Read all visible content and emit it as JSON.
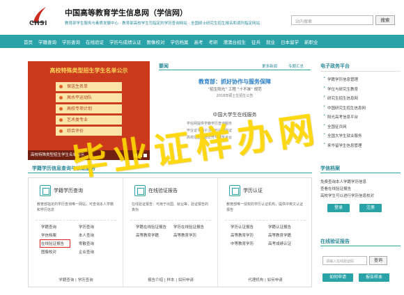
{
  "header": {
    "logo_text": "CHSI",
    "title": "中国高等教育学生信息网（学信网）",
    "slogan": "教育部学生服务与素质发展中心 · 教育部高校学生司指定的学历查询网站 · 全国硕士研究生招生报名和调剂指定网站",
    "search_placeholder": "站内搜索",
    "search_button": "搜索"
  },
  "nav": {
    "items": [
      "首页",
      "学籍查询",
      "学历查询",
      "在线验证",
      "学历与成绩认证",
      "图像校对",
      "学信档案",
      "高考",
      "考研",
      "港澳台招生",
      "征兵",
      "就业",
      "日本留学",
      "新职业"
    ]
  },
  "banner": {
    "title": "高校特殊类型招生学生名单公示",
    "items": [
      "保送生名单",
      "高水平运动队",
      "高校专项计划",
      "艺术类专业",
      "综合评价"
    ],
    "caption": "高校特殊类型招生学生名单公示"
  },
  "news": {
    "title": "要闻",
    "more1": "更多新闻",
    "more2": "专题汇总",
    "headline": "教育部：抓好协作与服务保障",
    "sub": "“招生阳光” 工程 “十不准” 规范",
    "date": "2018年硕士生招生公告",
    "headline2": "中国大学生在线服务",
    "lines": [
      "学信网提供学籍学历查询服务",
      "毕业证书电子注册与在线验证",
      "高校招生信息公开与服务平台"
    ]
  },
  "sidebar": {
    "title": "电子政务平台",
    "items": [
      "学籍学历信息管理",
      "学位与研究生教育",
      "研究生招生信息网",
      "中国研究生招生信息网",
      "阳光高考信息平台",
      "全国征兵网",
      "全国大学生就业服务",
      "来华留学生信息管理"
    ]
  },
  "section": {
    "title": "学籍学历信息查询与认证服务"
  },
  "panels": [
    {
      "title": "学籍学历查询",
      "desc": "教育部指定的学历查询唯一网站，可查询本人学籍和学历信息",
      "links": [
        "学籍查询",
        "学历查询",
        "学信档案",
        "本人查询",
        "在线验证报告",
        "零散查询",
        "图像校对",
        "企业查询"
      ],
      "foot": "学籍查询 | 学历查询"
    },
    {
      "title": "在线验证报告",
      "desc": "在线验证报告：可用于出国、就业等，验证报告的真伪",
      "links": [
        "学籍在线验证报告",
        "学历在线验证报告",
        "高等教育学籍",
        "高等教育学历"
      ],
      "foot": "报告介绍 | 样本 | 如何申请"
    },
    {
      "title": "学历认证",
      "desc": "教育部唯一授权的学历认证机构，提供中英文认证报告",
      "links": [
        "学历认证报告",
        "学籍认证报告",
        "高等教育学历",
        "高等教育学籍",
        "中等教育学历",
        "高考成绩认证"
      ],
      "foot": "代理机构 | 如何申请"
    }
  ],
  "sb2": {
    "title": "学信档案",
    "text": [
      "免费查询本人学籍学历信息",
      "查看在线验证报告",
      "高校学生可以进行学历信息校对"
    ],
    "btn_login": "登录",
    "btn_register": "注册"
  },
  "sb3": {
    "title": "在线验证报告",
    "placeholder": "请输入在线验证码",
    "verify_button": "查询",
    "btn_query": "如何申请",
    "btn_help": "报告样本"
  },
  "watermark": "毕业证样办网"
}
